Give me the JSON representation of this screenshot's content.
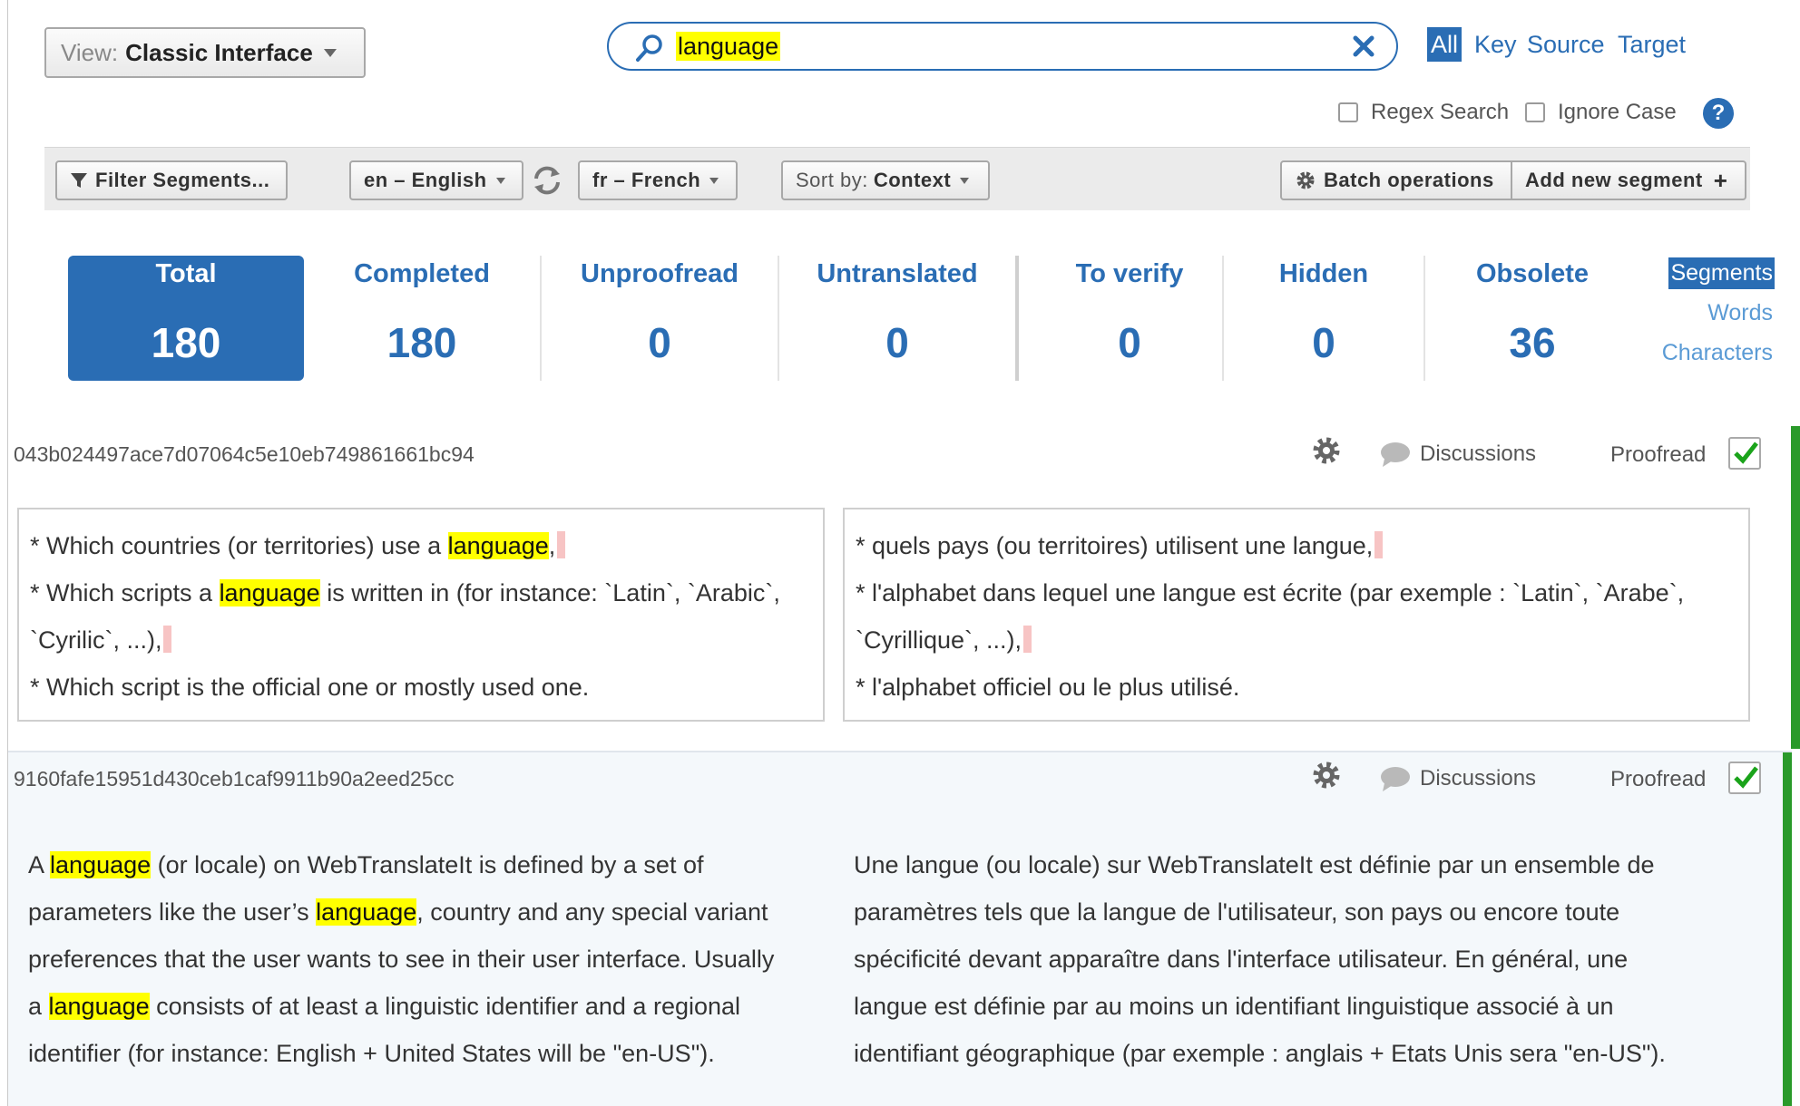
{
  "header": {
    "view_label": "View:",
    "view_value": "Classic Interface",
    "search_query": "language",
    "scopes": [
      "All",
      "Key",
      "Source",
      "Target"
    ],
    "regex_label": "Regex Search",
    "ignore_case_label": "Ignore Case",
    "help_glyph": "?"
  },
  "toolbar": {
    "filter_label": "Filter Segments...",
    "source_lang": "en – English",
    "target_lang": "fr – French",
    "sort_prefix": "Sort by:",
    "sort_value": "Context",
    "batch_label": "Batch operations",
    "add_label": "Add new segment"
  },
  "stats": [
    {
      "name": "Total",
      "value": "180"
    },
    {
      "name": "Completed",
      "value": "180"
    },
    {
      "name": "Unproofread",
      "value": "0"
    },
    {
      "name": "Untranslated",
      "value": "0"
    },
    {
      "name": "To verify",
      "value": "0"
    },
    {
      "name": "Hidden",
      "value": "0"
    },
    {
      "name": "Obsolete",
      "value": "36"
    }
  ],
  "units": [
    "Segments",
    "Words",
    "Characters"
  ],
  "segments": [
    {
      "key": "043b024497ace7d07064c5e10eb749861661bc94",
      "discussions_label": "Discussions",
      "proofread_label": "Proofread",
      "proofread": true,
      "source": {
        "l1a": "* Which countries (or territories) use a ",
        "l1b": "language",
        "l1c": ",",
        "l2a": "* Which scripts a ",
        "l2b": "language",
        "l2c": " is written in (for instance: `Latin`, `Arabic`,",
        "l3": "`Cyrilic`, ...),",
        "l4": "* Which script is the official one or mostly used one."
      },
      "target": {
        "l1": "* quels pays (ou territoires) utilisent une langue,",
        "l2": "* l'alphabet dans lequel une langue est écrite (par exemple : `Latin`, `Arabe`,",
        "l3": "`Cyrillique`, ...),",
        "l4": "* l'alphabet officiel ou le plus utilisé."
      }
    },
    {
      "key": "9160fafe15951d430ceb1caf9911b90a2eed25cc",
      "discussions_label": "Discussions",
      "proofread_label": "Proofread",
      "proofread": true,
      "source": {
        "l1a": "A ",
        "l1b": "language",
        "l1c": " (or locale) on WebTranslateIt is defined by a set of",
        "l2a": "parameters like the user’s ",
        "l2b": "language",
        "l2c": ", country and any special variant",
        "l3": "preferences that the user wants to see in their user interface. Usually",
        "l4a": "a ",
        "l4b": "language",
        "l4c": " consists of at least a linguistic identifier and a regional",
        "l5": "identifier (for instance: English + United States will be \"en-US\")."
      },
      "target": {
        "l1": "Une langue (ou locale) sur WebTranslateIt est définie par un ensemble de",
        "l2": "paramètres tels que la langue de l'utilisateur, son pays ou encore toute",
        "l3": "spécificité devant apparaître dans l'interface utilisateur. En général, une",
        "l4": "langue est définie par au moins un identifiant linguistique associé à un",
        "l5": "identifiant géographique (par exemple : anglais + Etats Unis sera \"en-US\")."
      }
    }
  ],
  "colors": {
    "accent": "#2a6db4",
    "highlight": "#ffff00",
    "proofread_green": "#2a9a2a"
  }
}
